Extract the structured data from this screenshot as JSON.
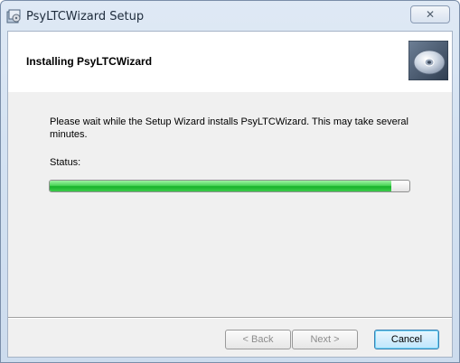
{
  "window": {
    "title": "PsyLTCWizard Setup",
    "close_glyph": "✕"
  },
  "banner": {
    "title": "Installing PsyLTCWizard",
    "image_icon": "cd-disc-icon"
  },
  "body": {
    "description": "Please wait while the Setup Wizard installs PsyLTCWizard.  This may take several minutes.",
    "status_label": "Status:",
    "progress_fraction": 0.95
  },
  "buttons": {
    "back": "< Back",
    "next": "Next >",
    "cancel": "Cancel"
  },
  "colors": {
    "progress_green": "#17b12a",
    "cancel_focus_border": "#3c7fb1"
  }
}
